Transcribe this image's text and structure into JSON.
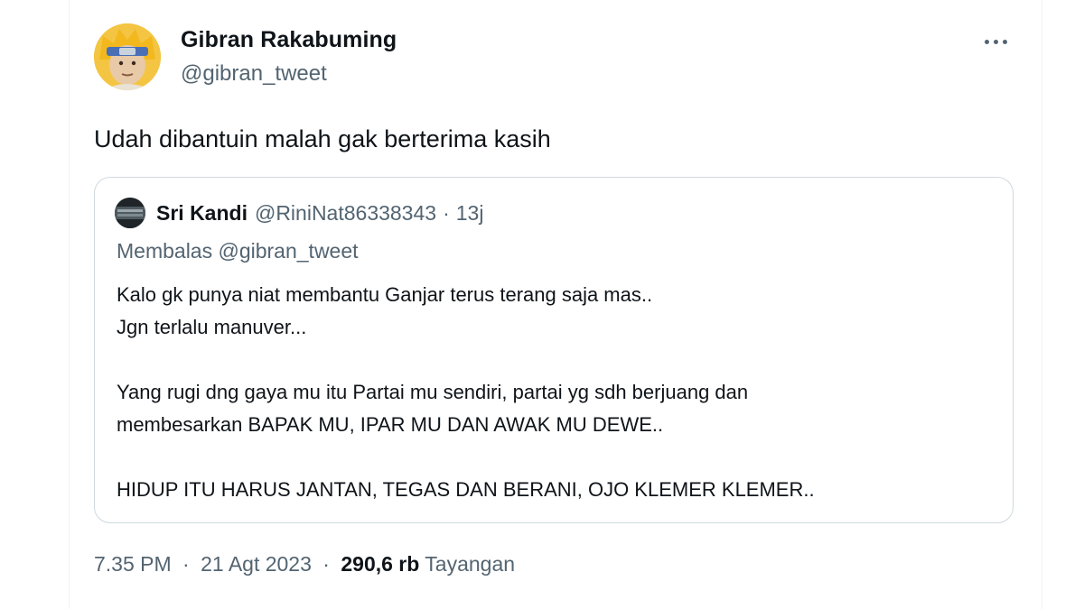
{
  "tweet": {
    "author": {
      "display_name": "Gibran Rakabuming",
      "handle": "@gibran_tweet",
      "avatar_icon": "avatar-icon"
    },
    "more_icon": "more-options-icon",
    "text": "Udah dibantuin malah gak berterima kasih",
    "quote": {
      "author": {
        "display_name": "Sri Kandi",
        "handle": "@RiniNat86338343",
        "separator": "·",
        "time": "13j"
      },
      "reply_to": "Membalas @gibran_tweet",
      "lines": [
        "Kalo gk punya niat membantu Ganjar terus terang saja mas..",
        "Jgn terlalu manuver...",
        "Yang rugi dng gaya mu itu Partai mu sendiri,  partai yg sdh berjuang dan",
        "membesarkan BAPAK MU,  IPAR MU DAN AWAK MU DEWE..",
        "HIDUP ITU HARUS JANTAN,  TEGAS DAN BERANI,  OJO KLEMER KLEMER.."
      ]
    },
    "meta": {
      "time": "7.35 PM",
      "separator": "·",
      "date": "21 Agt 2023",
      "views_count": "290,6 rb",
      "views_label": "Tayangan"
    },
    "colors": {
      "text": "#0f1419",
      "secondary": "#536471",
      "border": "#cfd9de"
    }
  }
}
